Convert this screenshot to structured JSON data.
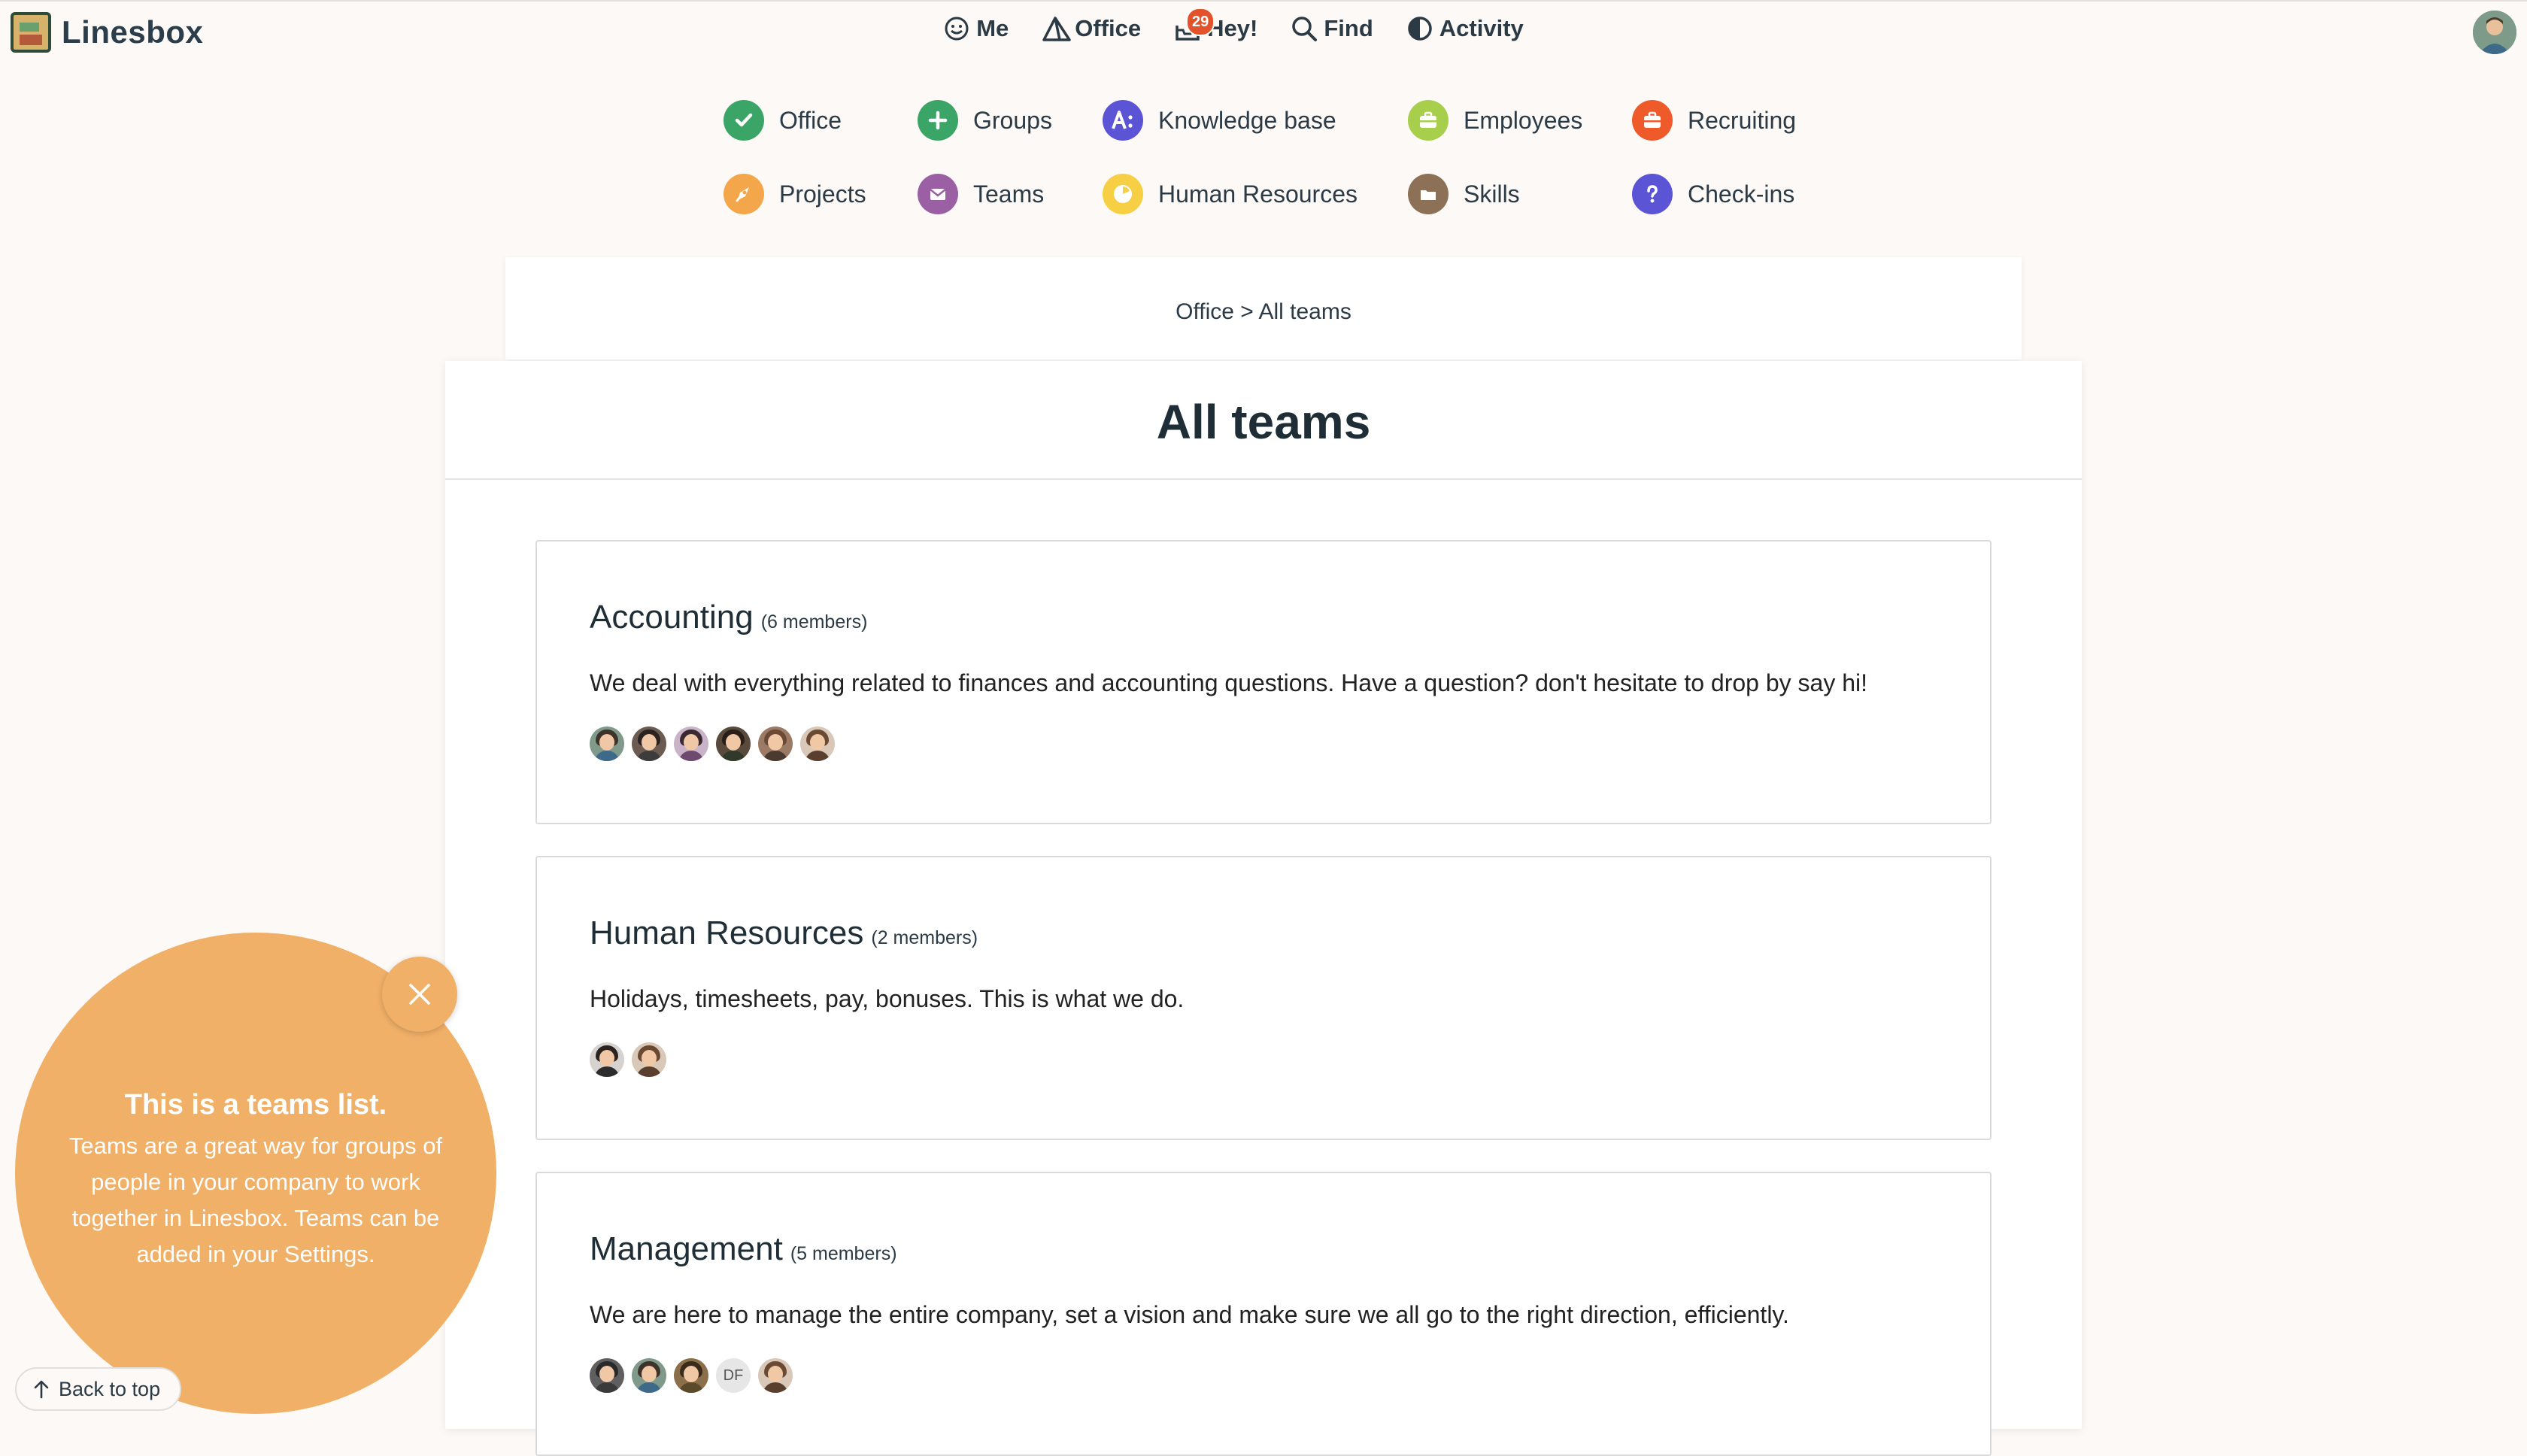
{
  "app": {
    "name": "Linesbox"
  },
  "top_nav": [
    {
      "label": "Me",
      "icon": "smiley-icon"
    },
    {
      "label": "Office",
      "icon": "office-tent-icon"
    },
    {
      "label": "Hey!",
      "icon": "hey-inbox-icon",
      "badge": "29"
    },
    {
      "label": "Find",
      "icon": "search-icon"
    },
    {
      "label": "Activity",
      "icon": "activity-half-circle-icon"
    }
  ],
  "apps": [
    {
      "label": "Office",
      "icon": "check-icon",
      "color": "#3aa566"
    },
    {
      "label": "Groups",
      "icon": "plus-icon",
      "color": "#3aa566"
    },
    {
      "label": "Knowledge base",
      "icon": "knowledge-icon",
      "color": "#5b55d6"
    },
    {
      "label": "Employees",
      "icon": "briefcase-icon",
      "color": "#a8cf4c"
    },
    {
      "label": "Recruiting",
      "icon": "recruiting-briefcase-icon",
      "color": "#ef5a2a"
    },
    {
      "label": "Projects",
      "icon": "rocket-icon",
      "color": "#f3a64a"
    },
    {
      "label": "Teams",
      "icon": "envelope-icon",
      "color": "#9b5fa3"
    },
    {
      "label": "Human Resources",
      "icon": "clock-icon",
      "color": "#f7cf45"
    },
    {
      "label": "Skills",
      "icon": "folder-icon",
      "color": "#8d7157"
    },
    {
      "label": "Check-ins",
      "icon": "question-icon",
      "color": "#5b55d6"
    }
  ],
  "breadcrumb": "Office > All teams",
  "page_title": "All teams",
  "teams": [
    {
      "name": "Accounting",
      "count": "(6 members)",
      "description": "We deal with everything related to finances and accounting questions. Have a question? don't hesitate to drop by say hi!",
      "members": [
        {
          "bg": "#7f9a8a",
          "hair": "#3d3328",
          "shirt": "#3e6a8a"
        },
        {
          "bg": "#6b5b50",
          "hair": "#2a2320",
          "shirt": "#3c3c3c"
        },
        {
          "bg": "#c9b3c8",
          "hair": "#3a2a30",
          "shirt": "#6d4a6e"
        },
        {
          "bg": "#5a4a3c",
          "hair": "#2a1f18",
          "shirt": "#2f3a2a"
        },
        {
          "bg": "#9c7b66",
          "hair": "#6a4a36",
          "shirt": "#4a3a30"
        },
        {
          "bg": "#d9c7b8",
          "hair": "#6b4a33",
          "shirt": "#5a3f2e"
        }
      ]
    },
    {
      "name": "Human Resources",
      "count": "(2 members)",
      "description": "Holidays, timesheets, pay, bonuses. This is what we do.",
      "members": [
        {
          "bg": "#d6d2cf",
          "hair": "#2a2320",
          "shirt": "#2c2c2c"
        },
        {
          "bg": "#d9c7b8",
          "hair": "#6b4a33",
          "shirt": "#5a3f2e"
        }
      ]
    },
    {
      "name": "Management",
      "count": "(5 members)",
      "description": "We are here to manage the entire company, set a vision and make sure we all go to the right direction, efficiently.",
      "members": [
        {
          "bg": "#5f5f5f",
          "hair": "#2a2a2a",
          "shirt": "#3a3a3a"
        },
        {
          "bg": "#7f9a8a",
          "hair": "#3d3328",
          "shirt": "#3e6a8a"
        },
        {
          "bg": "#8a6f4a",
          "hair": "#3a2a1a",
          "shirt": "#5a4a2a"
        },
        {
          "initials": "DF"
        },
        {
          "bg": "#d9c7b8",
          "hair": "#6b4a33",
          "shirt": "#5a3f2e"
        }
      ]
    }
  ],
  "tour": {
    "title": "This is a teams list.",
    "text": "Teams are a great way for groups of people in your company to work together in Linesbox. Teams can be added in your Settings."
  },
  "back_to_top": "Back to top"
}
